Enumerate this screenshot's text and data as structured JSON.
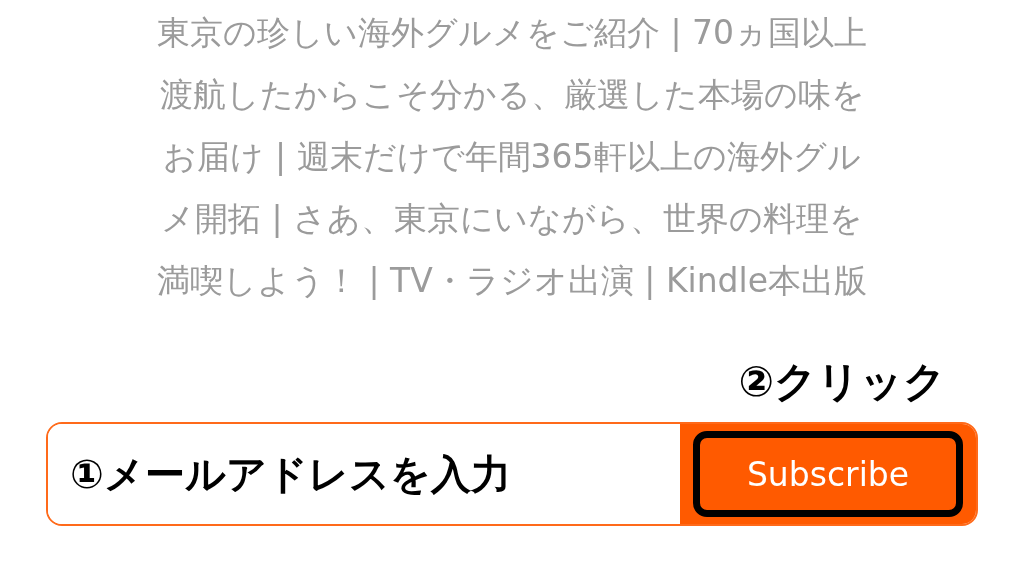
{
  "description_lines": [
    "東京の珍しい海外グルメをご紹介 | 70ヵ国以上",
    "渡航したからこそ分かる、厳選した本場の味を",
    "お届け | 週末だけで年間365軒以上の海外グル",
    "メ開拓 | さあ、東京にいながら、世界の料理を",
    "満喫しよう！ | TV・ラジオ出演 | Kindle本出版"
  ],
  "annotation_click": "②クリック",
  "form": {
    "annotation_input": "①メールアドレスを入力",
    "button": {
      "label": "Subscribe",
      "highlighted": true
    }
  }
}
